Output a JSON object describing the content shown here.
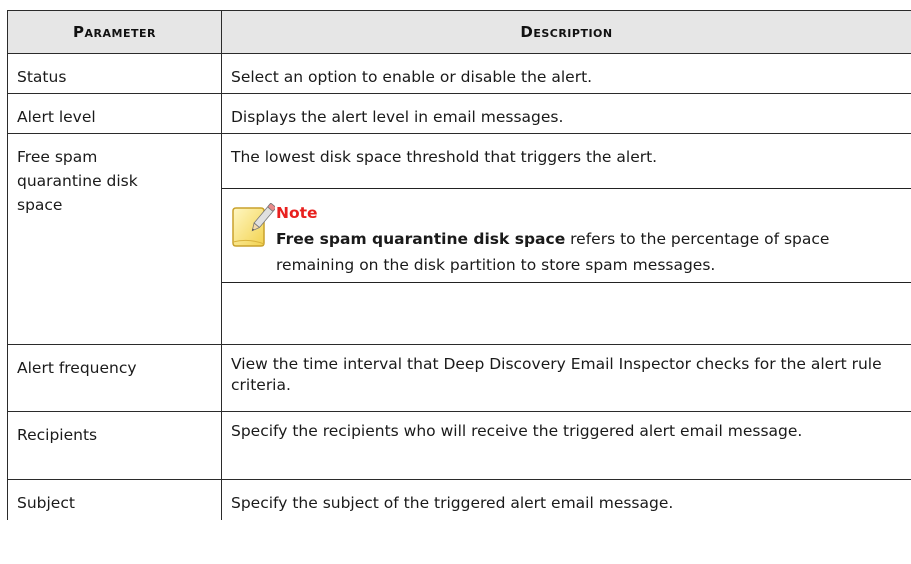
{
  "table": {
    "headers": [
      "Parameter",
      "Description"
    ],
    "rows": [
      {
        "parameter": "Status",
        "description": "Select an option to enable or disable the alert."
      },
      {
        "parameter": "Alert level",
        "description": "Displays the alert level in email messages."
      },
      {
        "parameter": "Free spam quarantine disk space",
        "description": "The lowest disk space threshold that triggers the alert."
      },
      {
        "parameter": "Alert frequency",
        "description": "View the time interval that Deep Discovery Email Inspector checks for the alert rule criteria."
      },
      {
        "parameter": "Recipients",
        "description": "Specify the recipients who will receive the triggered alert email message."
      },
      {
        "parameter": "Subject",
        "description": "Specify the subject of the triggered alert email message."
      }
    ]
  },
  "note": {
    "title": "Note",
    "bold_term": "Free spam quarantine disk space",
    "text": " refers to the percentage of space remaining on the disk partition to store spam messages.",
    "icon": "note-pencil-icon",
    "title_color": "#e8201e"
  }
}
